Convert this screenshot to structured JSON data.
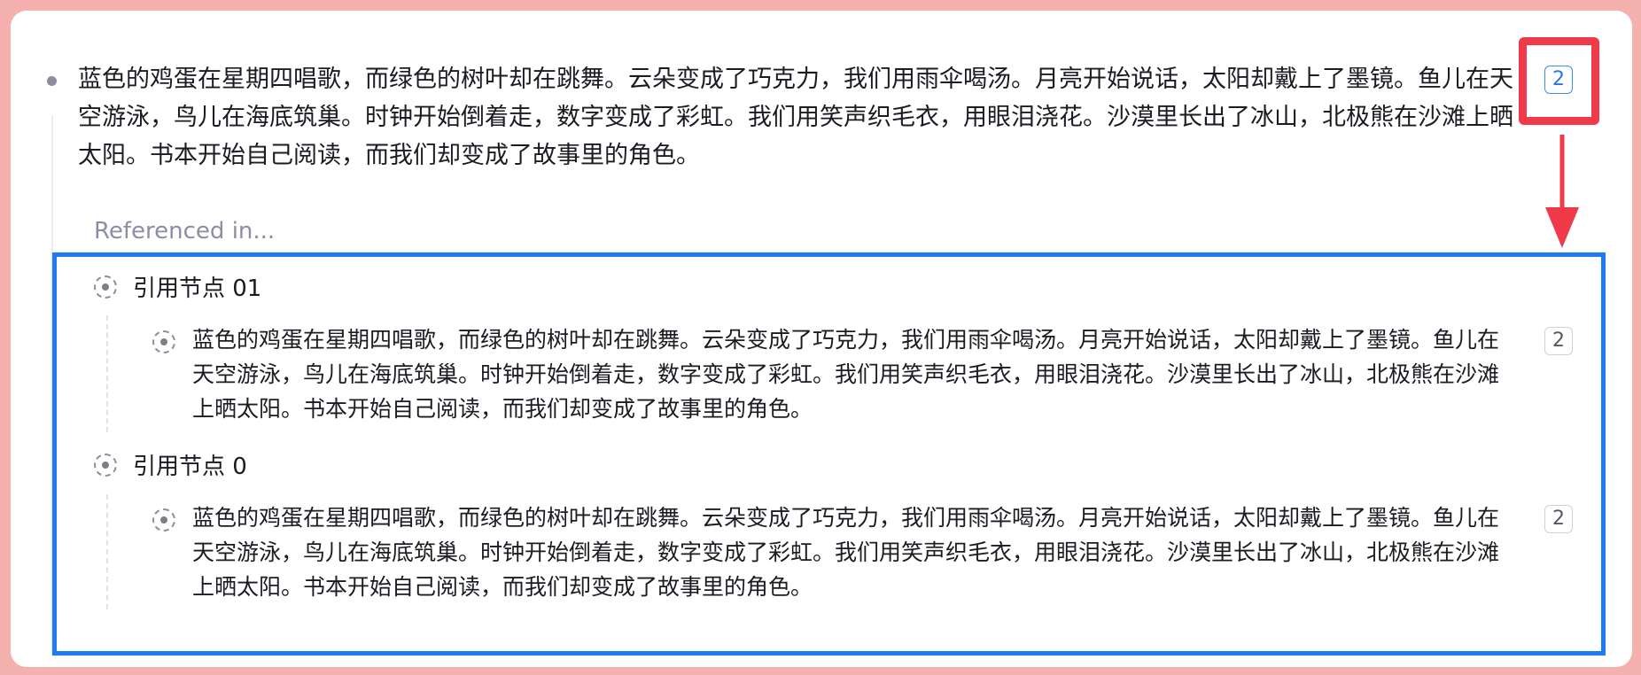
{
  "main": {
    "text": "蓝色的鸡蛋在星期四唱歌，而绿色的树叶却在跳舞。云朵变成了巧克力，我们用雨伞喝汤。月亮开始说话，太阳却戴上了墨镜。鱼儿在天空游泳，鸟儿在海底筑巢。时钟开始倒着走，数字变成了彩虹。我们用笑声织毛衣，用眼泪浇花。沙漠里长出了冰山，北极熊在沙滩上晒太阳。书本开始自己阅读，而我们却变成了故事里的角色。",
    "reference_count": "2"
  },
  "references": {
    "heading": "Referenced in...",
    "groups": [
      {
        "title": "引用节点 01",
        "child_text": "蓝色的鸡蛋在星期四唱歌，而绿色的树叶却在跳舞。云朵变成了巧克力，我们用雨伞喝汤。月亮开始说话，太阳却戴上了墨镜。鱼儿在天空游泳，鸟儿在海底筑巢。时钟开始倒着走，数字变成了彩虹。我们用笑声织毛衣，用眼泪浇花。沙漠里长出了冰山，北极熊在沙滩上晒太阳。书本开始自己阅读，而我们却变成了故事里的角色。",
        "child_count": "2"
      },
      {
        "title": "引用节点 0",
        "child_text": "蓝色的鸡蛋在星期四唱歌，而绿色的树叶却在跳舞。云朵变成了巧克力，我们用雨伞喝汤。月亮开始说话，太阳却戴上了墨镜。鱼儿在天空游泳，鸟儿在海底筑巢。时钟开始倒着走，数字变成了彩虹。我们用笑声织毛衣，用眼泪浇花。沙漠里长出了冰山，北极熊在沙滩上晒太阳。书本开始自己阅读，而我们却变成了故事里的角色。",
        "child_count": "2"
      }
    ]
  },
  "colors": {
    "frame_background": "#f4b1ad",
    "highlight_red": "#f03a4a",
    "highlight_blue": "#1f7bf2",
    "badge_active": "#2b74e6"
  },
  "icons": {
    "main_bullet": "bullet-dot-icon",
    "reference_node": "reference-node-icon",
    "annotation_arrow": "down-arrow-icon"
  }
}
